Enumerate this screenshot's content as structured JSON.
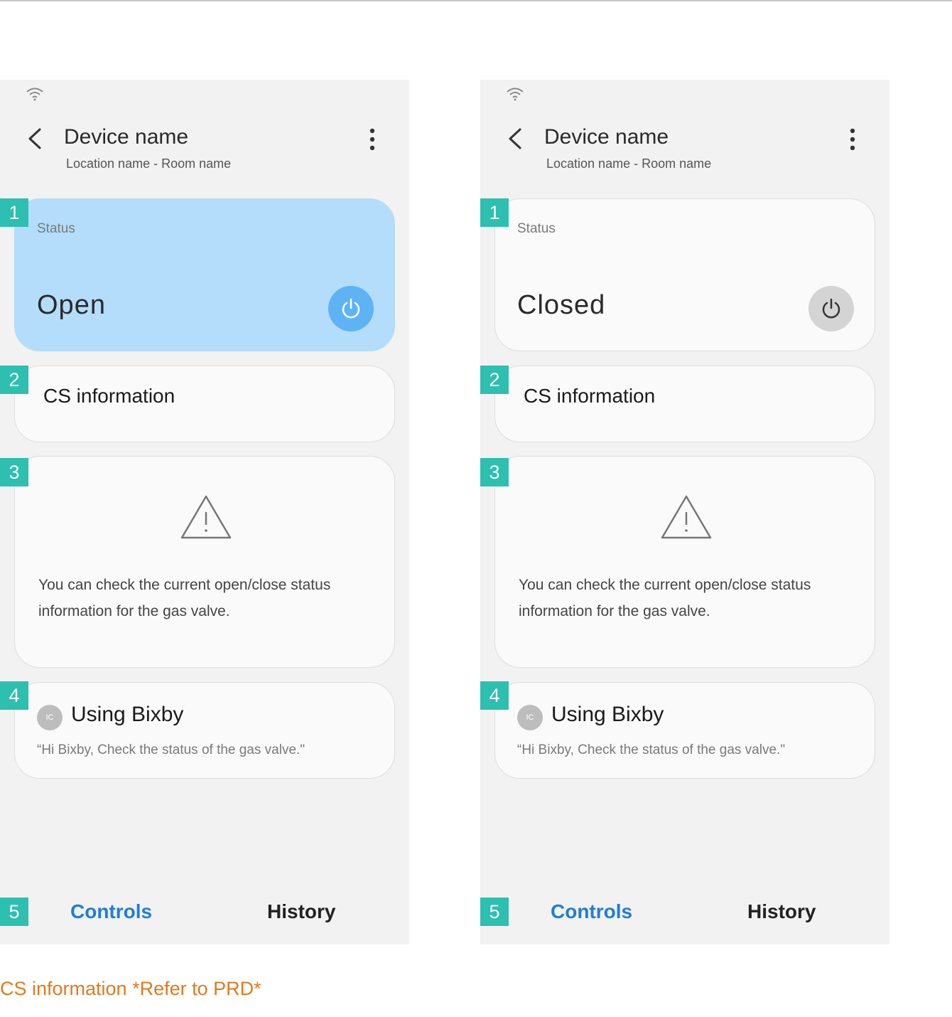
{
  "screens": [
    {
      "header": {
        "title": "Device name",
        "subtitle": "Location name - Room name"
      },
      "status": {
        "label": "Status",
        "value": "Open",
        "power_state": "on"
      },
      "cs": {
        "label": "CS information"
      },
      "info": {
        "text": "You can check the current open/close status information for the gas valve."
      },
      "bixby": {
        "badge": "IC",
        "title": "Using Bixby",
        "quote": "“Hi Bixby, Check the status of the gas valve.\""
      },
      "tabs": {
        "controls": "Controls",
        "history": "History"
      }
    },
    {
      "header": {
        "title": "Device name",
        "subtitle": "Location name - Room name"
      },
      "status": {
        "label": "Status",
        "value": "Closed",
        "power_state": "off"
      },
      "cs": {
        "label": "CS information"
      },
      "info": {
        "text": "You can check the current open/close status information for the gas valve."
      },
      "bixby": {
        "badge": "IC",
        "title": "Using Bixby",
        "quote": "“Hi Bixby, Check the status of the gas valve.\""
      },
      "tabs": {
        "controls": "Controls",
        "history": "History"
      }
    }
  ],
  "markers": [
    "1",
    "2",
    "3",
    "4",
    "5"
  ],
  "footnote": "CS information *Refer to PRD*",
  "colors": {
    "accent": "#1f7ed6",
    "marker": "#2dbfb0",
    "status_on": "#b3ddfb",
    "power_on": "#5eb3f5",
    "power_off": "#d4d4d4",
    "note": "#e07a1f"
  }
}
